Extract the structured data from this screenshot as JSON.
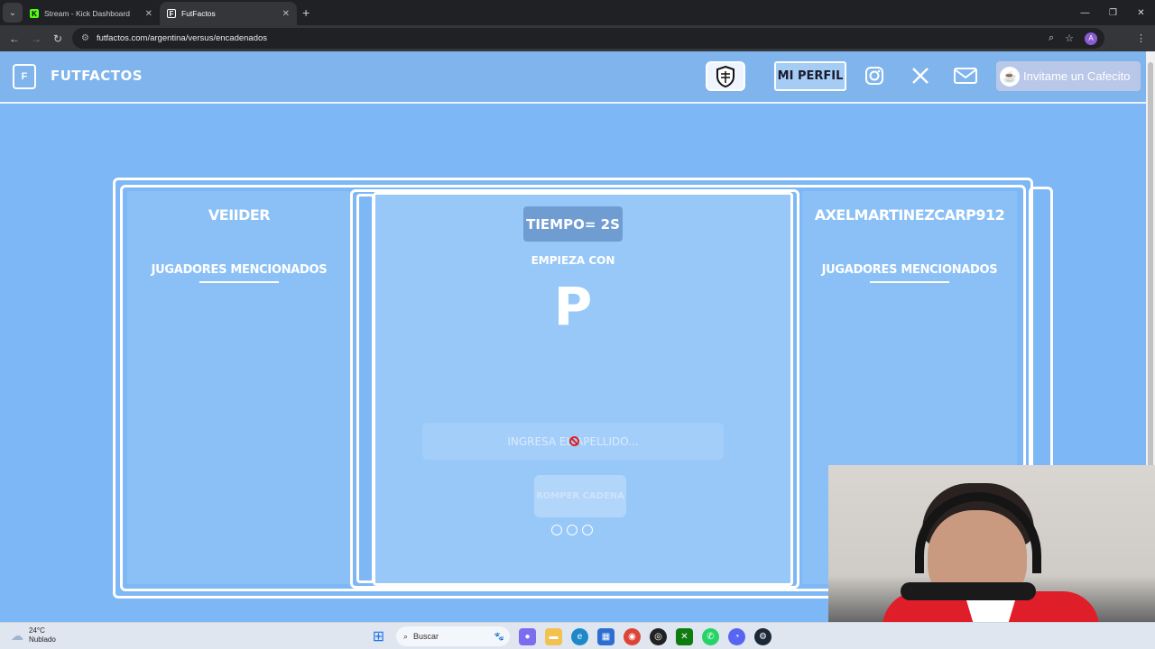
{
  "browser": {
    "tabs": [
      {
        "title": "Stream - Kick Dashboard",
        "favicon": "kick-icon"
      },
      {
        "title": "FutFactos",
        "favicon": "futfactos-icon"
      }
    ],
    "url": "futfactos.com/argentina/versus/encadenados"
  },
  "header": {
    "brand": "FUTFACTOS",
    "profile_label": "MI PERFIL",
    "cafecito_label": "Invitame un Cafecito"
  },
  "game": {
    "player_left": "VEIIDER",
    "player_right": "AXELMARTINEZCARP912",
    "mentioned_label": "JUGADORES MENCIONADOS",
    "timer": "TIEMPO= 2S",
    "starts_with_label": "EMPIEZA CON",
    "letter": "P",
    "input_placeholder": "INGRESA EL APELLIDO...",
    "break_button": "ROMPER CADENA"
  },
  "taskbar": {
    "temperature": "24°C",
    "condition": "Nublado",
    "search_label": "Buscar"
  },
  "colors": {
    "page_bg": "#7db7f5",
    "panel_bg": "#97c8f8",
    "timer_bg": "#6f9cd1"
  }
}
